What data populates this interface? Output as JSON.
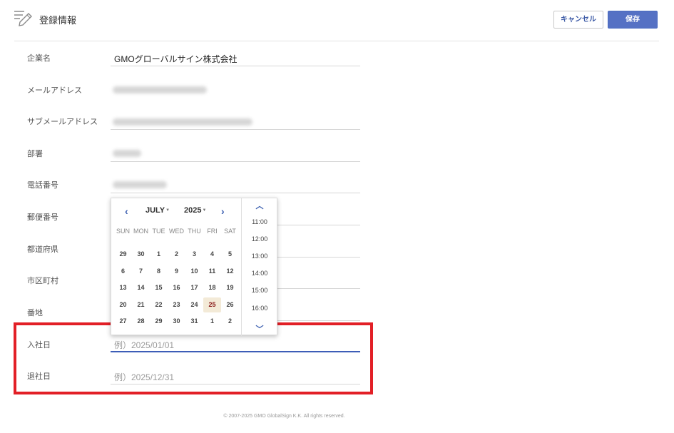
{
  "header": {
    "title": "登録情報",
    "cancel_label": "キャンセル",
    "save_label": "保存"
  },
  "form": {
    "company_label": "企業名",
    "company_value": "GMOグローバルサイン株式会社",
    "email_label": "メールアドレス",
    "sub_email_label": "サブメールアドレス",
    "department_label": "部署",
    "phone_label": "電話番号",
    "postal_label": "郵便番号",
    "prefecture_label": "都道府県",
    "city_label": "市区町村",
    "address_label": "番地",
    "join_date_label": "入社日",
    "join_date_placeholder": "例）2025/01/01",
    "leave_date_label": "退社日",
    "leave_date_placeholder": "例）2025/12/31"
  },
  "datepicker": {
    "month": "JULY",
    "year": "2025",
    "weekdays": [
      "SUN",
      "MON",
      "TUE",
      "WED",
      "THU",
      "FRI",
      "SAT"
    ],
    "weeks": [
      [
        "29",
        "30",
        "1",
        "2",
        "3",
        "4",
        "5"
      ],
      [
        "6",
        "7",
        "8",
        "9",
        "10",
        "11",
        "12"
      ],
      [
        "13",
        "14",
        "15",
        "16",
        "17",
        "18",
        "19"
      ],
      [
        "20",
        "21",
        "22",
        "23",
        "24",
        "25",
        "26"
      ],
      [
        "27",
        "28",
        "29",
        "30",
        "31",
        "1",
        "2"
      ]
    ],
    "today": "25",
    "times": [
      "11:00",
      "12:00",
      "13:00",
      "14:00",
      "15:00",
      "16:00"
    ],
    "accent_color": "#3b5fb0"
  },
  "footer": {
    "copyright": "© 2007-2025 GMO GlobalSign K.K. All rights reserved."
  },
  "colors": {
    "primary": "#5571c4",
    "highlight_border": "#e21f26"
  }
}
